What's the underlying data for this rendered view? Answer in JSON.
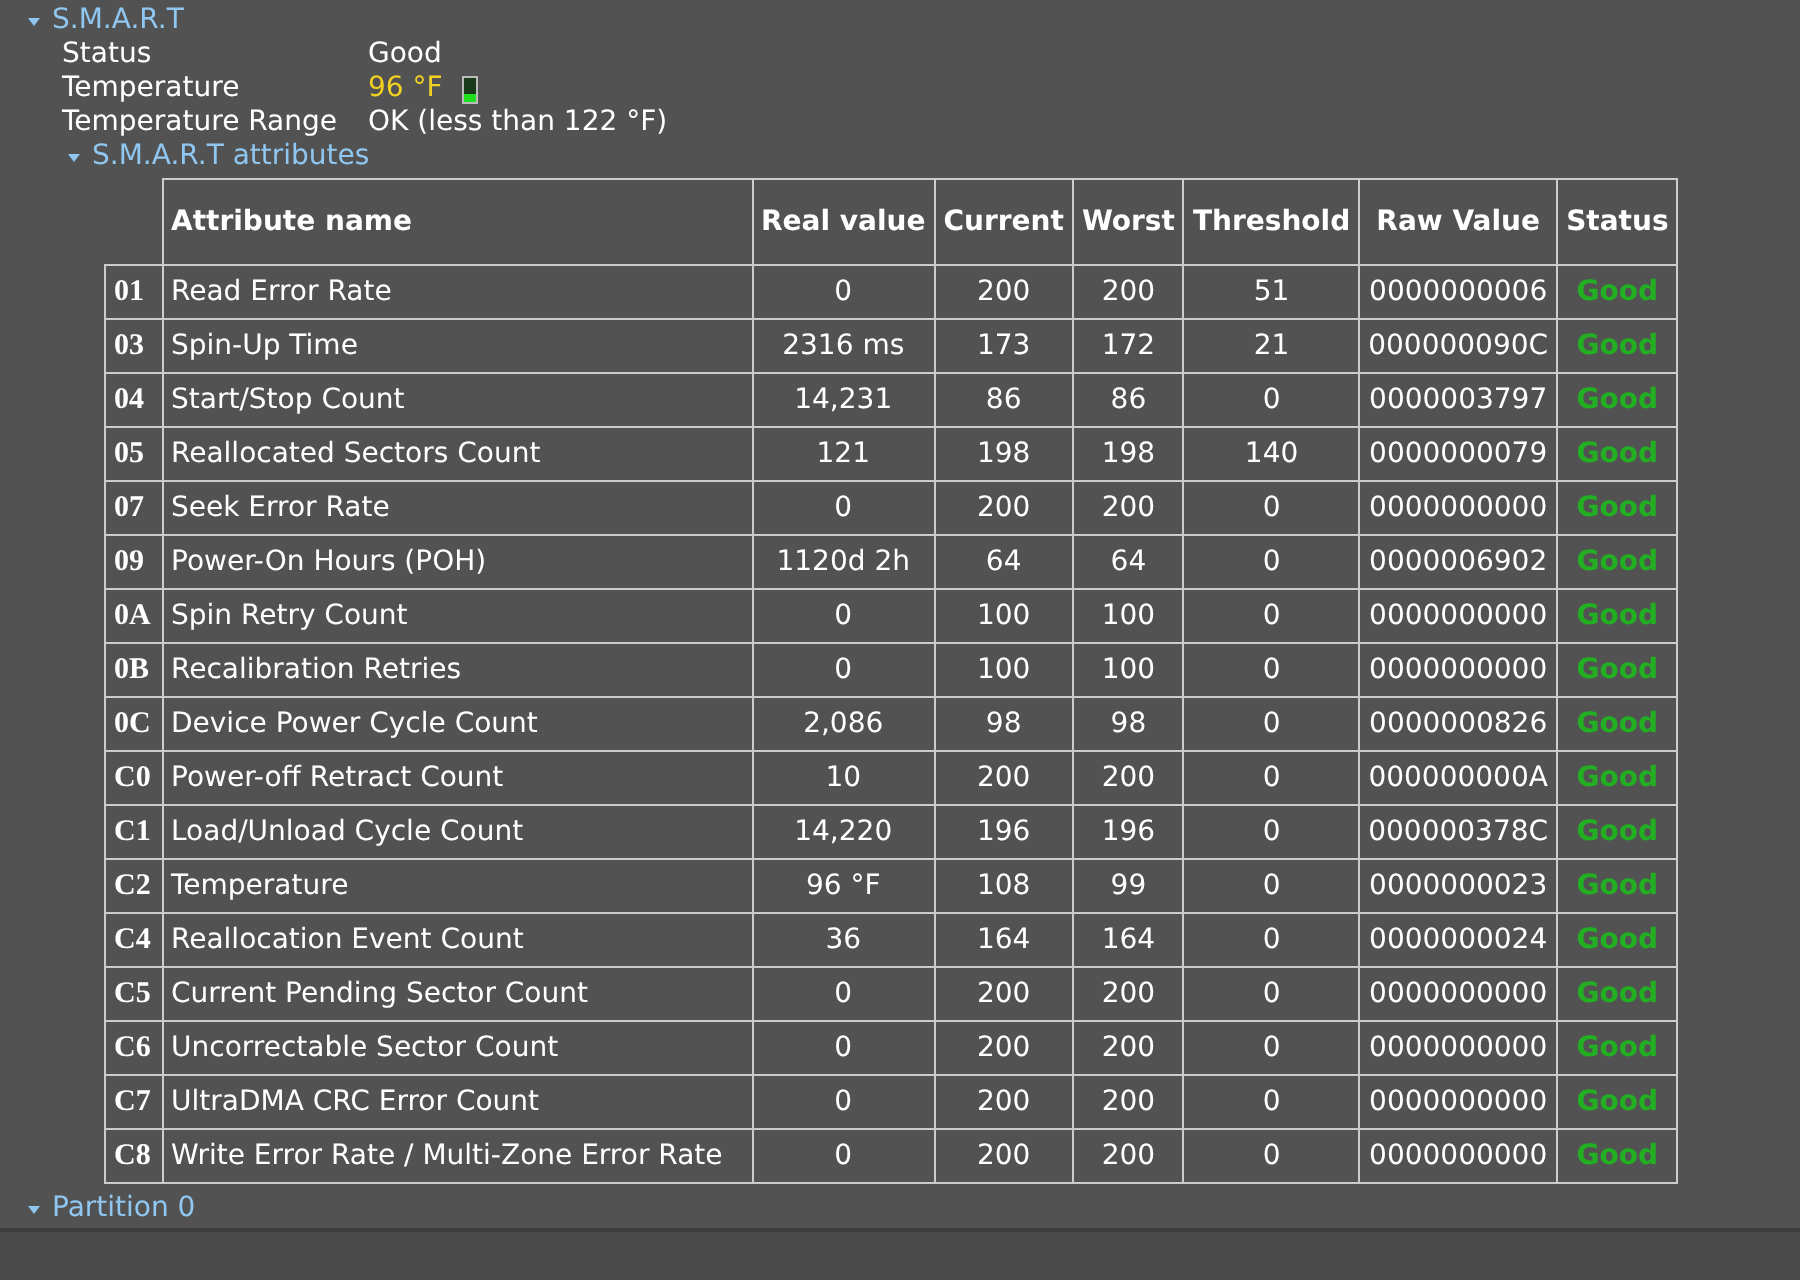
{
  "smart": {
    "title": "S.M.A.R.T",
    "expanded": true,
    "info": [
      {
        "label": "Status",
        "value": "Good",
        "kind": "text"
      },
      {
        "label": "Temperature",
        "value": "96 °F",
        "kind": "temperature",
        "level": 0.3
      },
      {
        "label": "Temperature Range",
        "value": "OK (less than 122 °F)",
        "kind": "text"
      }
    ],
    "attributes": {
      "title": "S.M.A.R.T attributes",
      "expanded": true,
      "columns": [
        "Attribute name",
        "Real value",
        "Current",
        "Worst",
        "Threshold",
        "Raw Value",
        "Status"
      ],
      "rows": [
        {
          "id": "01",
          "name": "Read Error Rate",
          "real": "0",
          "current": "200",
          "worst": "200",
          "threshold": "51",
          "raw": "0000000006",
          "status": "Good"
        },
        {
          "id": "03",
          "name": "Spin-Up Time",
          "real": "2316 ms",
          "current": "173",
          "worst": "172",
          "threshold": "21",
          "raw": "000000090C",
          "status": "Good"
        },
        {
          "id": "04",
          "name": "Start/Stop Count",
          "real": "14,231",
          "current": "86",
          "worst": "86",
          "threshold": "0",
          "raw": "0000003797",
          "status": "Good"
        },
        {
          "id": "05",
          "name": "Reallocated Sectors Count",
          "real": "121",
          "current": "198",
          "worst": "198",
          "threshold": "140",
          "raw": "0000000079",
          "status": "Good"
        },
        {
          "id": "07",
          "name": "Seek Error Rate",
          "real": "0",
          "current": "200",
          "worst": "200",
          "threshold": "0",
          "raw": "0000000000",
          "status": "Good"
        },
        {
          "id": "09",
          "name": "Power-On Hours (POH)",
          "real": "1120d 2h",
          "current": "64",
          "worst": "64",
          "threshold": "0",
          "raw": "0000006902",
          "status": "Good"
        },
        {
          "id": "0A",
          "name": "Spin Retry Count",
          "real": "0",
          "current": "100",
          "worst": "100",
          "threshold": "0",
          "raw": "0000000000",
          "status": "Good"
        },
        {
          "id": "0B",
          "name": "Recalibration Retries",
          "real": "0",
          "current": "100",
          "worst": "100",
          "threshold": "0",
          "raw": "0000000000",
          "status": "Good"
        },
        {
          "id": "0C",
          "name": "Device Power Cycle Count",
          "real": "2,086",
          "current": "98",
          "worst": "98",
          "threshold": "0",
          "raw": "0000000826",
          "status": "Good"
        },
        {
          "id": "C0",
          "name": "Power-off Retract Count",
          "real": "10",
          "current": "200",
          "worst": "200",
          "threshold": "0",
          "raw": "000000000A",
          "status": "Good"
        },
        {
          "id": "C1",
          "name": "Load/Unload Cycle Count",
          "real": "14,220",
          "current": "196",
          "worst": "196",
          "threshold": "0",
          "raw": "000000378C",
          "status": "Good"
        },
        {
          "id": "C2",
          "name": "Temperature",
          "real": "96 °F",
          "current": "108",
          "worst": "99",
          "threshold": "0",
          "raw": "0000000023",
          "status": "Good"
        },
        {
          "id": "C4",
          "name": "Reallocation Event Count",
          "real": "36",
          "current": "164",
          "worst": "164",
          "threshold": "0",
          "raw": "0000000024",
          "status": "Good"
        },
        {
          "id": "C5",
          "name": "Current Pending Sector Count",
          "real": "0",
          "current": "200",
          "worst": "200",
          "threshold": "0",
          "raw": "0000000000",
          "status": "Good"
        },
        {
          "id": "C6",
          "name": "Uncorrectable Sector Count",
          "real": "0",
          "current": "200",
          "worst": "200",
          "threshold": "0",
          "raw": "0000000000",
          "status": "Good"
        },
        {
          "id": "C7",
          "name": "UltraDMA CRC Error Count",
          "real": "0",
          "current": "200",
          "worst": "200",
          "threshold": "0",
          "raw": "0000000000",
          "status": "Good"
        },
        {
          "id": "C8",
          "name": "Write Error Rate / Multi-Zone Error Rate",
          "real": "0",
          "current": "200",
          "worst": "200",
          "threshold": "0",
          "raw": "0000000000",
          "status": "Good"
        }
      ]
    }
  },
  "partition": {
    "title": "Partition 0",
    "expanded": true
  }
}
